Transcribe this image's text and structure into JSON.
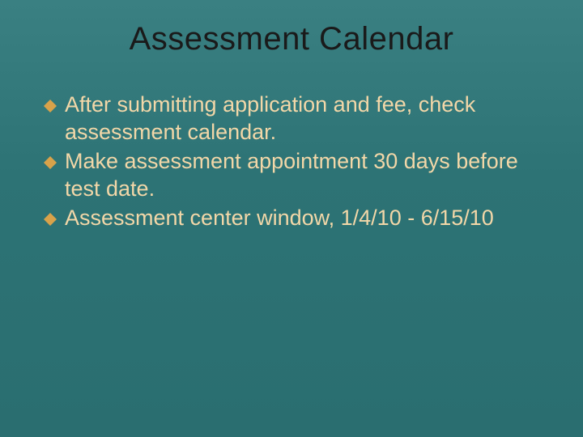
{
  "colors": {
    "background": "#2d7375",
    "title": "#1a1a1a",
    "body_text": "#f2d7a8",
    "bullet": "#d8a24a"
  },
  "title": "Assessment Calendar",
  "bullets": [
    "After submitting application and fee, check assessment calendar.",
    "Make assessment appointment 30 days before test date.",
    "Assessment center window, 1/4/10 - 6/15/10"
  ]
}
